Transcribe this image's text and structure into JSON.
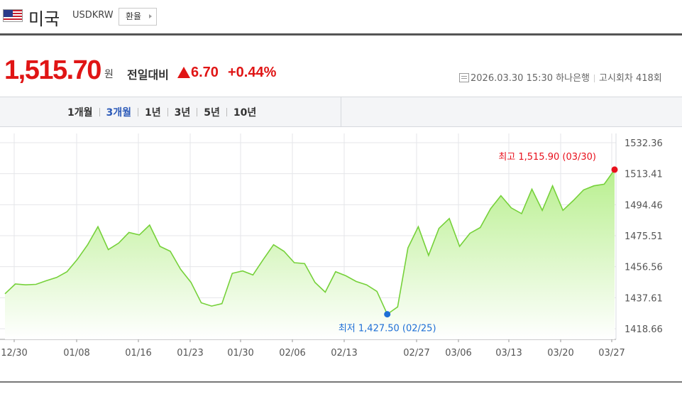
{
  "header": {
    "country": "미국",
    "ticker": "USDKRW",
    "exchange_button": "환율"
  },
  "quote": {
    "price": "1,515.70",
    "unit": "원",
    "prev_label": "전일대비",
    "change": "6.70",
    "change_pct": "+0.44%",
    "datetime": "2026.03.30 15:30",
    "bank": "하나은행",
    "notice": "고시회차 418회"
  },
  "period_tabs": [
    {
      "label": "1개월",
      "active": false
    },
    {
      "label": "3개월",
      "active": true
    },
    {
      "label": "1년",
      "active": false
    },
    {
      "label": "3년",
      "active": false
    },
    {
      "label": "5년",
      "active": false
    },
    {
      "label": "10년",
      "active": false
    }
  ],
  "colors": {
    "up": "#e01515",
    "line": "#76d13a",
    "fill_top": "#b8ef8e",
    "high_marker": "#e8101c",
    "low_marker": "#1e6fd6",
    "low_label": "#1e6fd6"
  },
  "chart_data": {
    "type": "area",
    "title": "",
    "xlabel": "",
    "ylabel": "",
    "ylim": [
      1418.66,
      1532.36
    ],
    "yticks": [
      1532.36,
      1513.41,
      1494.46,
      1475.51,
      1456.56,
      1437.61,
      1418.66
    ],
    "x_ticks": [
      "12/30",
      "01/08",
      "01/16",
      "01/23",
      "01/30",
      "02/06",
      "02/13",
      "02/27",
      "03/06",
      "03/13",
      "03/20",
      "03/27"
    ],
    "grid": true,
    "legend": "none",
    "series": [
      {
        "values": [
          1440.0,
          1446.0,
          1445.5,
          1445.8,
          1448.0,
          1450.0,
          1453.5,
          1461.0,
          1470.0,
          1481.0,
          1467.0,
          1471.0,
          1477.5,
          1476.0,
          1482.0,
          1469.0,
          1466.0,
          1455.0,
          1447.0,
          1434.5,
          1432.5,
          1434.0,
          1452.5,
          1454.0,
          1451.5,
          1461.0,
          1470.0,
          1466.0,
          1459.0,
          1458.5,
          1447.0,
          1441.0,
          1453.5,
          1451.0,
          1447.5,
          1445.5,
          1441.5,
          1427.5,
          1432.0,
          1468.0,
          1481.0,
          1463.5,
          1480.0,
          1486.0,
          1469.0,
          1477.0,
          1480.5,
          1492.0,
          1500.0,
          1492.5,
          1489.0,
          1504.0,
          1491.0,
          1506.0,
          1491.0,
          1497.0,
          1503.5,
          1506.0,
          1507.0,
          1515.9
        ]
      }
    ],
    "annotations": {
      "high": {
        "label": "최고 1,515.90 (03/30)",
        "value": 1515.9,
        "index": 59
      },
      "low": {
        "label": "최저 1,427.50 (02/25)",
        "value": 1427.5,
        "index": 37
      }
    }
  }
}
